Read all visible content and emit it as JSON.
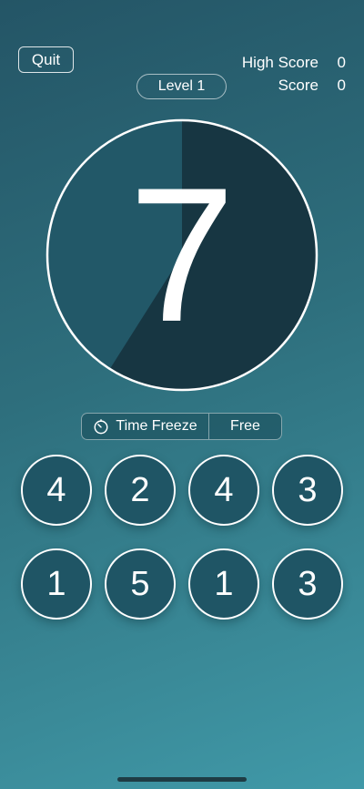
{
  "header": {
    "quit_label": "Quit",
    "high_score_label": "High Score",
    "high_score_value": "0",
    "score_label": "Score",
    "score_value": "0",
    "level_label": "Level 1"
  },
  "timer": {
    "target_number": "7",
    "remaining_fraction": 0.59,
    "dial_color": "#173642",
    "elapsed_color": "#225868",
    "ring_color": "#ffffff"
  },
  "powerup": {
    "icon": "stopwatch-icon",
    "name": "Time Freeze",
    "cost": "Free"
  },
  "number_buttons": {
    "row1": [
      "4",
      "2",
      "4",
      "3"
    ],
    "row2": [
      "1",
      "5",
      "1",
      "3"
    ]
  },
  "colors": {
    "button_fill": "#1f5565",
    "background_top": "#245566",
    "background_bottom": "#4099a8"
  }
}
